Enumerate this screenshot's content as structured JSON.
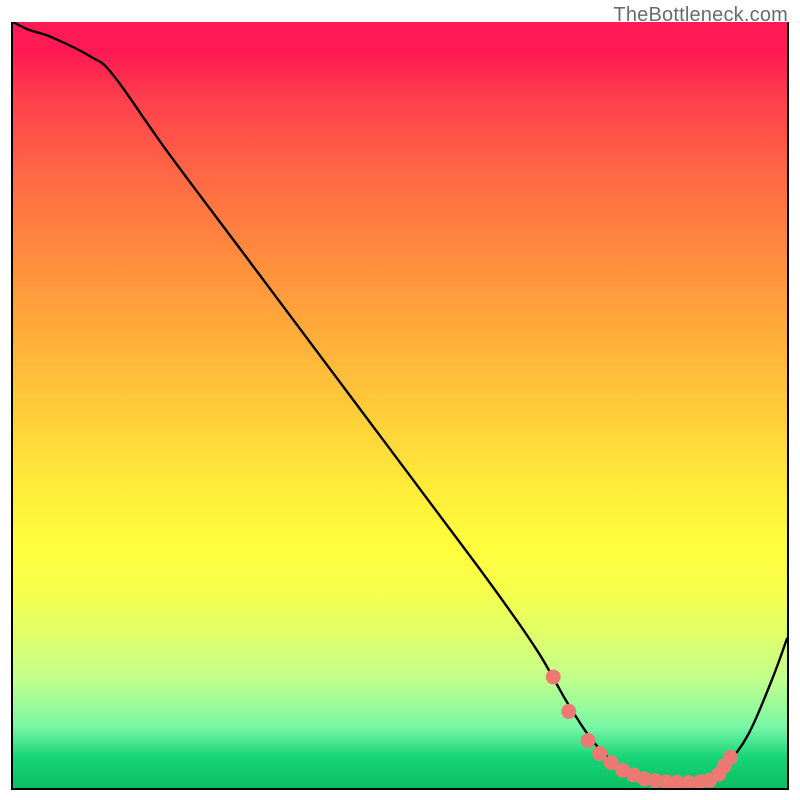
{
  "watermark": "TheBottleneck.com",
  "colors": {
    "curve_stroke": "#000000",
    "dot_fill": "#ed7a72",
    "dot_stroke": "#d95f57",
    "gradient_top": "#ff1a54",
    "gradient_bottom": "#0bbf63"
  },
  "chart_data": {
    "type": "line",
    "title": "",
    "xlabel": "",
    "ylabel": "",
    "xlim": [
      0,
      100
    ],
    "ylim": [
      0,
      100
    ],
    "grid": false,
    "legend_position": "none",
    "series": [
      {
        "name": "bottleneck-curve",
        "x": [
          0,
          2,
          5,
          10,
          13,
          20,
          30,
          40,
          50,
          60,
          65,
          68,
          70,
          72,
          75,
          78,
          80,
          82,
          85,
          88,
          90,
          92,
          95,
          98,
          100
        ],
        "y": [
          100,
          99,
          98,
          95.5,
          93,
          83,
          69.5,
          56,
          42.5,
          29,
          22,
          17.5,
          14,
          10.5,
          6,
          3,
          1.8,
          1.1,
          0.7,
          0.7,
          1.2,
          2.8,
          7,
          14,
          19.5
        ]
      }
    ],
    "markers": {
      "name": "optimal-range-dots",
      "x": [
        69.8,
        71.8,
        74.3,
        75.8,
        77.3,
        78.8,
        80.2,
        81.6,
        83.0,
        84.4,
        85.8,
        87.3,
        88.8,
        90.0,
        91.2,
        91.9,
        92.7
      ],
      "y": [
        14.5,
        10.0,
        6.2,
        4.5,
        3.3,
        2.3,
        1.7,
        1.2,
        0.95,
        0.8,
        0.75,
        0.7,
        0.8,
        1.0,
        1.8,
        2.9,
        4.0
      ]
    }
  }
}
